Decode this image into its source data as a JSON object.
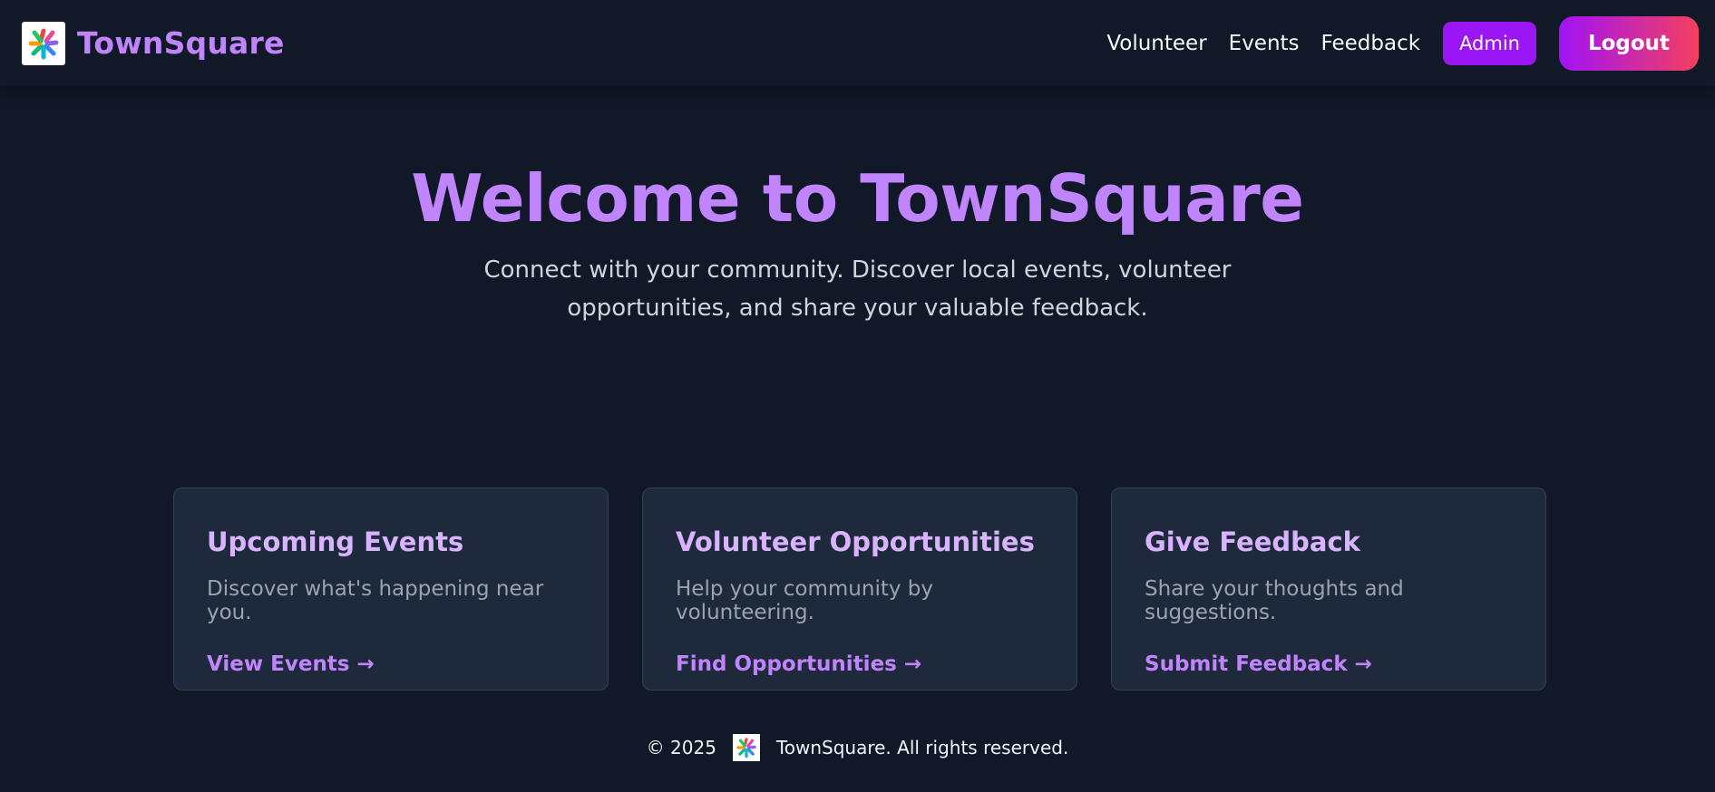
{
  "header": {
    "brand_name": "TownSquare",
    "logo_icon": "townsquare-logo",
    "nav": {
      "volunteer": "Volunteer",
      "events": "Events",
      "feedback": "Feedback"
    },
    "admin_label": "Admin",
    "logout_label": "Logout"
  },
  "hero": {
    "title": "Welcome to TownSquare",
    "subtitle": "Connect with your community. Discover local events, volunteer opportunities, and share your valuable feedback."
  },
  "cards": [
    {
      "title": "Upcoming Events",
      "description": "Discover what's happening near you.",
      "link": "View Events →"
    },
    {
      "title": "Volunteer Opportunities",
      "description": "Help your community by volunteering.",
      "link": "Find Opportunities →"
    },
    {
      "title": "Give Feedback",
      "description": "Share your thoughts and suggestions.",
      "link": "Submit Feedback →"
    }
  ],
  "footer": {
    "copyright": "© 2025",
    "text": "TownSquare. All rights reserved."
  },
  "colors": {
    "background": "#111827",
    "accent": "#c084fc",
    "card": "#1e293b",
    "admin_button": "#9a16f5",
    "logout_gradient_start": "#a112f7",
    "logout_gradient_end": "#f43f5e"
  }
}
